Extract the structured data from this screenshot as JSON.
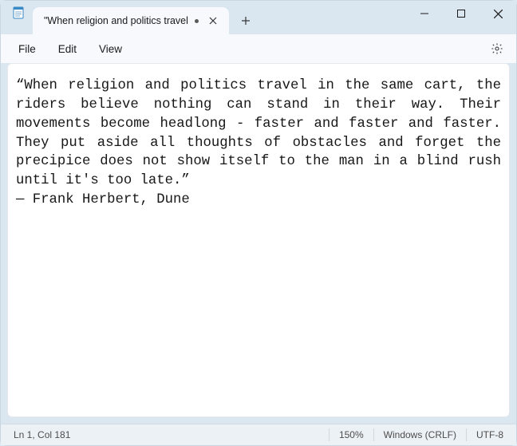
{
  "window": {
    "tab_title": "\"When religion and politics travel",
    "modified": true
  },
  "menubar": {
    "file": "File",
    "edit": "Edit",
    "view": "View"
  },
  "editor": {
    "content": "“When religion and politics travel in the same cart, the riders believe nothing can stand in their way. Their movements become headlong - faster and faster and faster. They put aside all thoughts of obstacles and forget the precipice does not show itself to the man in a blind rush until it's too late.”\n― Frank Herbert, Dune"
  },
  "statusbar": {
    "position": "Ln 1, Col 181",
    "zoom": "150%",
    "line_ending": "Windows (CRLF)",
    "encoding": "UTF-8"
  }
}
